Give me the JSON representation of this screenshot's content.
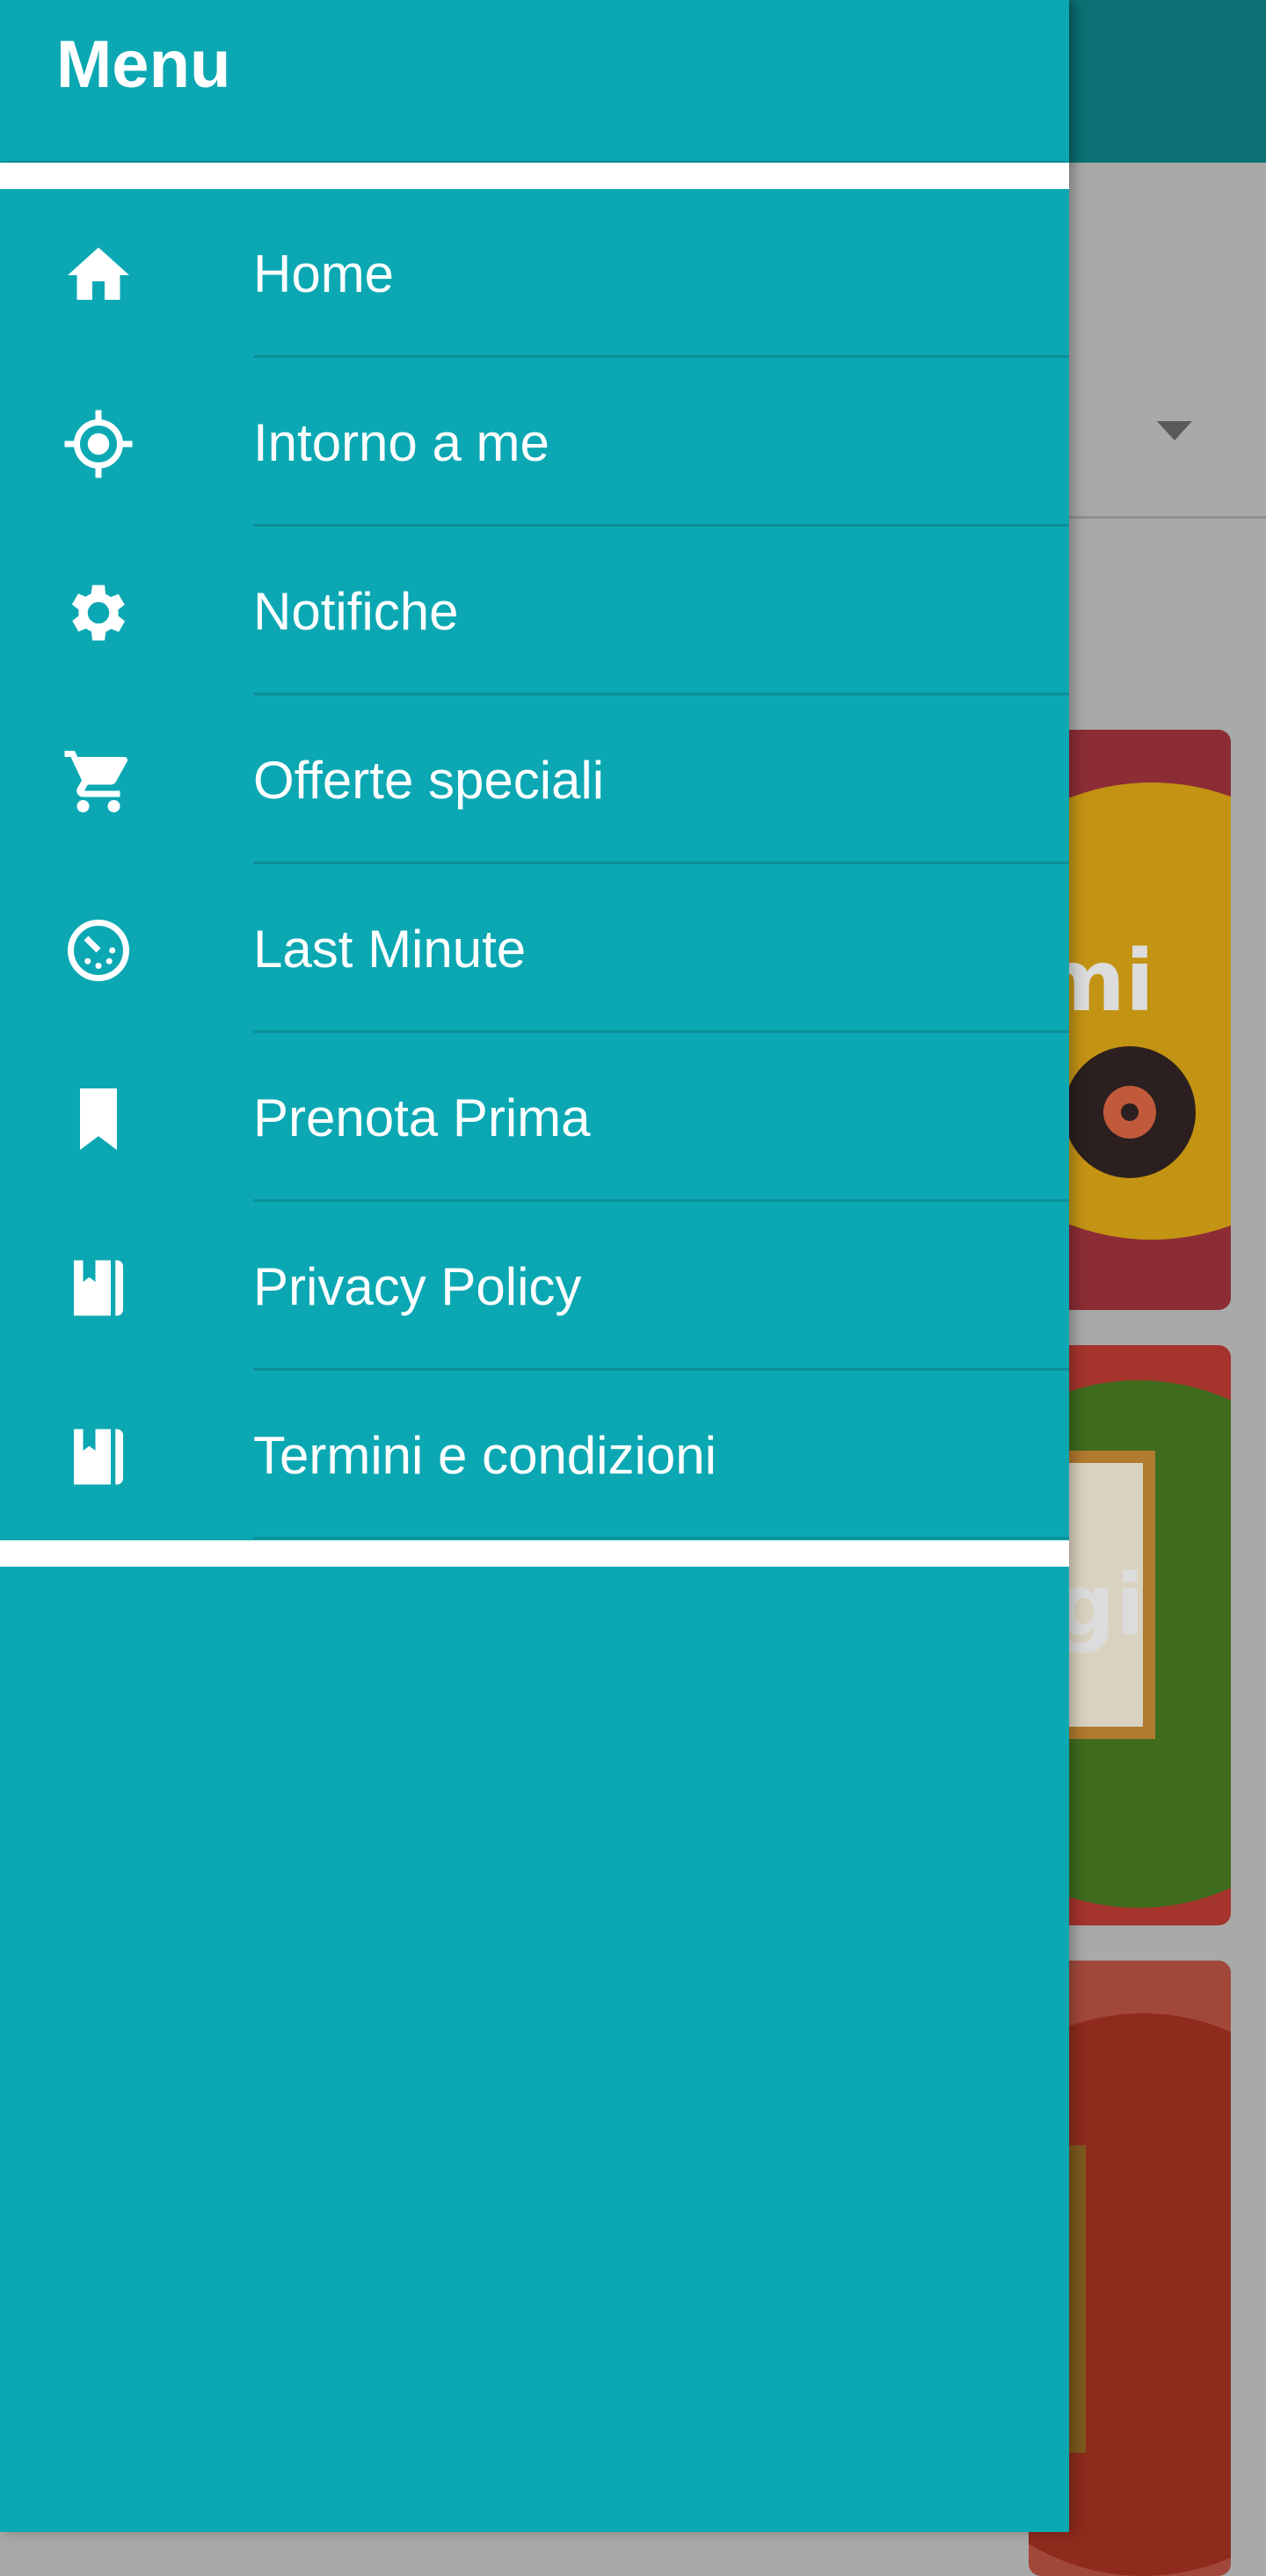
{
  "drawer": {
    "title": "Menu",
    "items": [
      {
        "label": "Home",
        "icon": "home-icon"
      },
      {
        "label": "Intorno a me",
        "icon": "location-target-icon"
      },
      {
        "label": "Notifiche",
        "icon": "gear-icon"
      },
      {
        "label": "Offerte speciali",
        "icon": "cart-icon"
      },
      {
        "label": "Last Minute",
        "icon": "timer-icon"
      },
      {
        "label": "Prenota Prima",
        "icon": "bookmark-icon"
      },
      {
        "label": "Privacy Policy",
        "icon": "book-icon"
      },
      {
        "label": "Termini e condizioni",
        "icon": "book-icon"
      }
    ]
  },
  "background": {
    "card_fragments": [
      "mi",
      "gi"
    ]
  },
  "colors": {
    "drawer": "#0ba8b3",
    "appbar": "#0b7174",
    "text": "#ffffff"
  }
}
